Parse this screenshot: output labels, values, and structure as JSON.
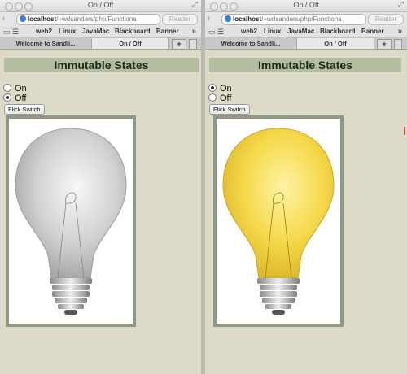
{
  "windows": [
    {
      "title": "On / Off",
      "url_host": "localhost",
      "url_rest": "/~wdsanders/php/Functiona",
      "reader": "Reader",
      "bookmarks": [
        "web2",
        "Linux",
        "JavaMac",
        "Blackboard",
        "Banner"
      ],
      "tabs": [
        "Welcome to Sandli...",
        "On / Off"
      ],
      "heading": "Immutable States",
      "radio_on": "On",
      "radio_off": "Off",
      "selected": "Off",
      "button": "Flick Switch",
      "bulb_state": "off",
      "bulb_color": "#cfcfcf"
    },
    {
      "title": "On / Off",
      "url_host": "localhost",
      "url_rest": "/~wdsanders/php/Functiona",
      "reader": "Reader",
      "bookmarks": [
        "web2",
        "Linux",
        "JavaMac",
        "Blackboard",
        "Banner"
      ],
      "tabs": [
        "Welcome to Sandli...",
        "On / Off"
      ],
      "heading": "Immutable States",
      "radio_on": "On",
      "radio_off": "Off",
      "selected": "On",
      "button": "Flick Switch",
      "bulb_state": "on",
      "bulb_color": "#f5d94a"
    }
  ]
}
